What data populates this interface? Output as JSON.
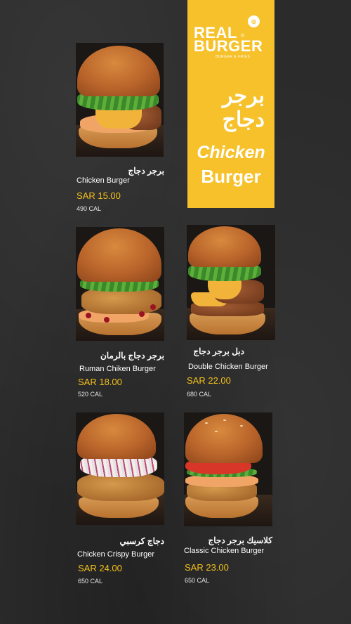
{
  "brand": {
    "name_line1": "REAL",
    "name_line2": "BURGER",
    "tagline": "BURGER & FRIES",
    "registered": "®"
  },
  "banner": {
    "title_ar_line1": "برجر",
    "title_ar_line2": "دجاج",
    "title_en_line1": "Chicken",
    "title_en_line2": "Burger"
  },
  "colors": {
    "background": "#2b2b2b",
    "banner": "#f6c12a",
    "price": "#f3c01b",
    "text": "#ffffff"
  },
  "items": [
    {
      "name_ar": "برجر دجاج",
      "name_en": "Chicken Burger",
      "price": "SAR 15.00",
      "calories": "490 CAL"
    },
    {
      "name_ar": "برجر دجاج بالرمان",
      "name_en": "Ruman Chiken Burger",
      "price": "SAR 18.00",
      "calories": "520 CAL"
    },
    {
      "name_ar": "دبل برجر دجاج",
      "name_en": "Double Chicken Burger",
      "price": "SAR 22.00",
      "calories": "680 CAL"
    },
    {
      "name_ar": "دجاج كرسبي",
      "name_en": "Chicken Crispy Burger",
      "price": "SAR 24.00",
      "calories": "650 CAL"
    },
    {
      "name_ar": "كلاسيك برجر دجاج",
      "name_en": "Classic Chicken Burger",
      "price": "SAR 23.00",
      "calories": "650 CAL"
    }
  ]
}
